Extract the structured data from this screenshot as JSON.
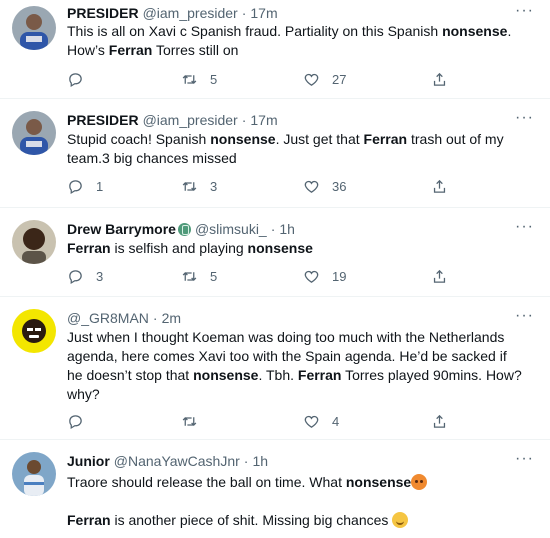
{
  "tweets": [
    {
      "name": "PRESIDER",
      "handle": "@iam_presider",
      "time": "17m",
      "body": [
        [
          {
            "t": "This is all on Xavi c Spanish fraud. Partiality on this Spanish ",
            "b": false
          },
          {
            "t": "nonsense",
            "b": true
          },
          {
            "t": ". How’s ",
            "b": false
          },
          {
            "t": "Ferran",
            "b": true
          },
          {
            "t": " Torres still on",
            "b": false
          }
        ]
      ],
      "replies": "",
      "retweets": "5",
      "likes": "27"
    },
    {
      "name": "PRESIDER",
      "handle": "@iam_presider",
      "time": "17m",
      "body": [
        [
          {
            "t": "Stupid coach! Spanish ",
            "b": false
          },
          {
            "t": "nonsense",
            "b": true
          },
          {
            "t": ". Just get that ",
            "b": false
          },
          {
            "t": "Ferran",
            "b": true
          },
          {
            "t": " trash out of my team.3 big chances missed",
            "b": false
          }
        ]
      ],
      "replies": "1",
      "retweets": "3",
      "likes": "36"
    },
    {
      "name": "Drew Barrymore",
      "handle": "@slimsuki_",
      "time": "1h",
      "body": [
        [
          {
            "t": "Ferran",
            "b": true
          },
          {
            "t": " is selfish and playing ",
            "b": false
          },
          {
            "t": "nonsense",
            "b": true
          }
        ]
      ],
      "replies": "3",
      "retweets": "5",
      "likes": "19"
    },
    {
      "name": "",
      "handle": "@_GR8MAN",
      "time": "2m",
      "body": [
        [
          {
            "t": "Just when I thought Koeman was doing too much with the Netherlands agenda, here comes Xavi too with the Spain agenda. He’d be sacked if he doesn’t stop that ",
            "b": false
          },
          {
            "t": "nonsense",
            "b": true
          },
          {
            "t": ". Tbh. ",
            "b": false
          },
          {
            "t": "Ferran",
            "b": true
          },
          {
            "t": " Torres played 90mins. How? why?",
            "b": false
          }
        ]
      ],
      "replies": "",
      "retweets": "",
      "likes": "4"
    },
    {
      "name": "Junior",
      "handle": "@NanaYawCashJnr",
      "time": "1h",
      "body": [
        [
          {
            "t": "Traore should release the ball on time. What ",
            "b": false
          },
          {
            "t": "nonsense",
            "b": true
          }
        ],
        [
          {
            "t": "Ferran",
            "b": true
          },
          {
            "t": " is another piece of shit. Missing big chances ",
            "b": false
          }
        ]
      ],
      "replies": "",
      "retweets": "",
      "likes": ""
    }
  ],
  "icons": {
    "reply": "reply-icon",
    "retweet": "retweet-icon",
    "like": "heart-icon",
    "share": "share-icon",
    "more": "more-icon",
    "verified": "badge-icon",
    "emoji_angry": "angry-face-emoji",
    "emoji_smirk": "smirk-face-emoji"
  },
  "colors": {
    "text": "#0f1419",
    "muted": "#536471",
    "divider": "#eff3f4"
  }
}
